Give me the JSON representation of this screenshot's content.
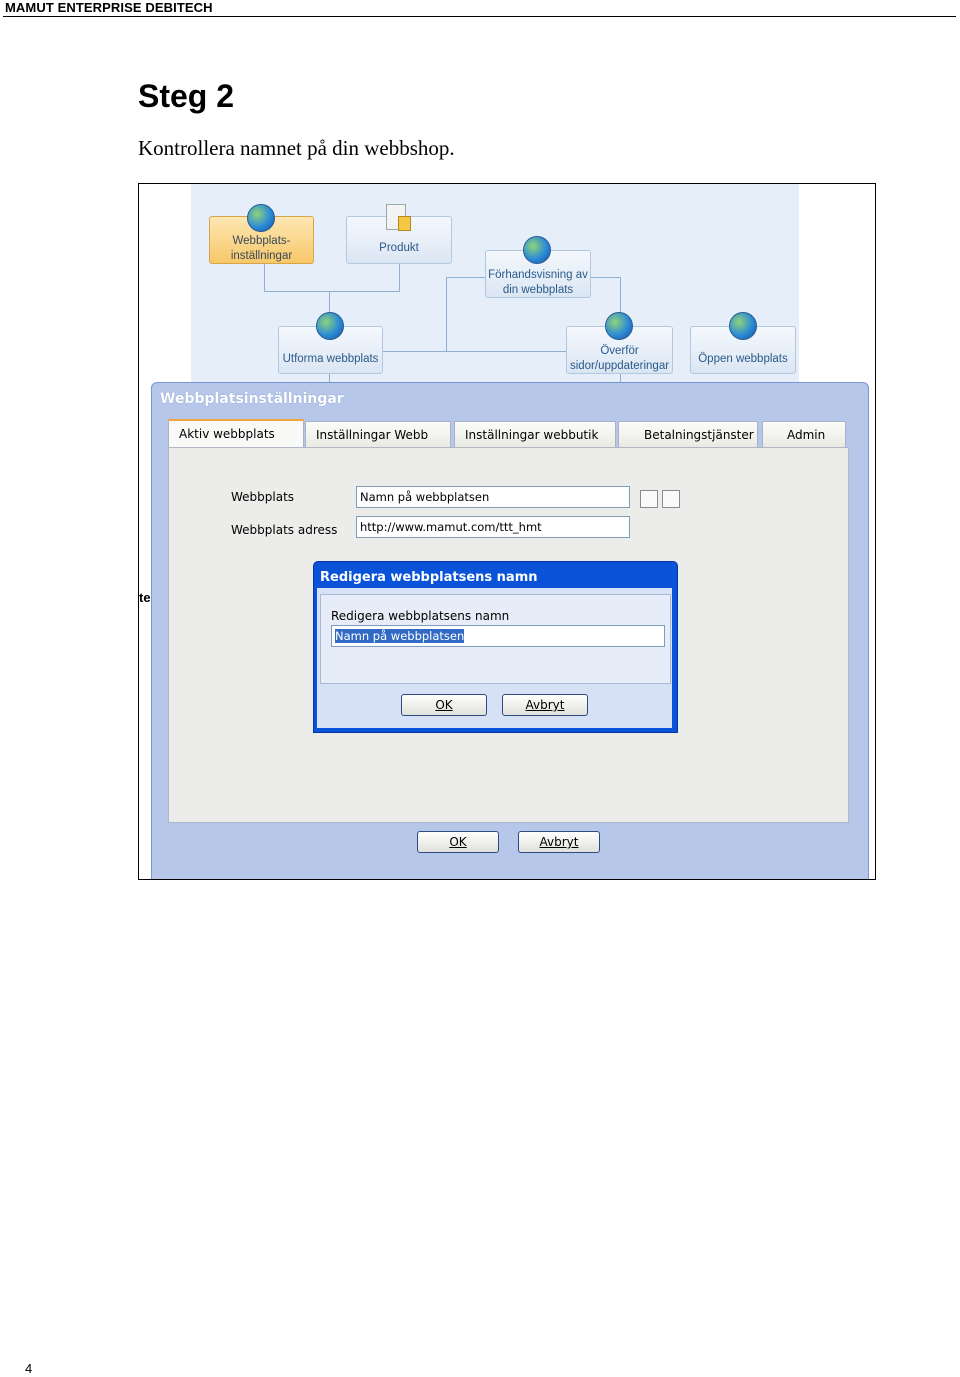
{
  "header": {
    "title": "MAMUT ENTERPRISE DEBITECH"
  },
  "heading": {
    "title": "Steg 2",
    "description": "Kontrollera namnet på din webbshop."
  },
  "page": {
    "number": "4"
  },
  "screenshot": {
    "workflow": {
      "steps": [
        {
          "id": "settings",
          "label_1": "Webbplats-",
          "label_2": "inställningar",
          "active": true,
          "icon": "globe-gear-icon"
        },
        {
          "id": "product",
          "label_1": "Produkt",
          "icon": "product-box-icon"
        },
        {
          "id": "preview",
          "label_1": "Förhandsvisning av",
          "label_2": "din webbplats",
          "icon": "globe-preview-icon"
        },
        {
          "id": "design",
          "label_1": "Utforma webbplats",
          "icon": "globe-pencil-icon"
        },
        {
          "id": "transfer",
          "label_1": "Överför",
          "label_2": "sidor/uppdateringar",
          "icon": "globe-computer-icon"
        },
        {
          "id": "open",
          "label_1": "Öppen webbplats",
          "icon": "globe-house-icon"
        }
      ]
    },
    "stray_text": "te",
    "window": {
      "title": "Webbplatsinställningar",
      "tabs": [
        {
          "label": "Aktiv webbplats",
          "active": true
        },
        {
          "label": "Inställningar Webb"
        },
        {
          "label": "Inställningar webbutik"
        },
        {
          "label": "Betalningstjänster"
        },
        {
          "label": "Admin"
        }
      ],
      "fields": {
        "site_label": "Webbplats",
        "site_value": "Namn på webbplatsen",
        "address_label": "Webbplats adress",
        "address_value": "http://www.mamut.com/ttt_hmt"
      },
      "ok_label": "OK",
      "cancel_label": "Avbryt"
    },
    "dialog": {
      "title": "Redigera webbplatsens namn",
      "field_label": "Redigera webbplatsens namn",
      "field_value": "Namn på webbplatsen",
      "ok_label": "OK",
      "cancel_label": "Avbryt"
    },
    "colors": {
      "dialog_title": "#0a53d8",
      "window_frame": "#b7c7ea",
      "active_tab_accent": "#f2a53d",
      "active_step": "#f7c869"
    }
  }
}
